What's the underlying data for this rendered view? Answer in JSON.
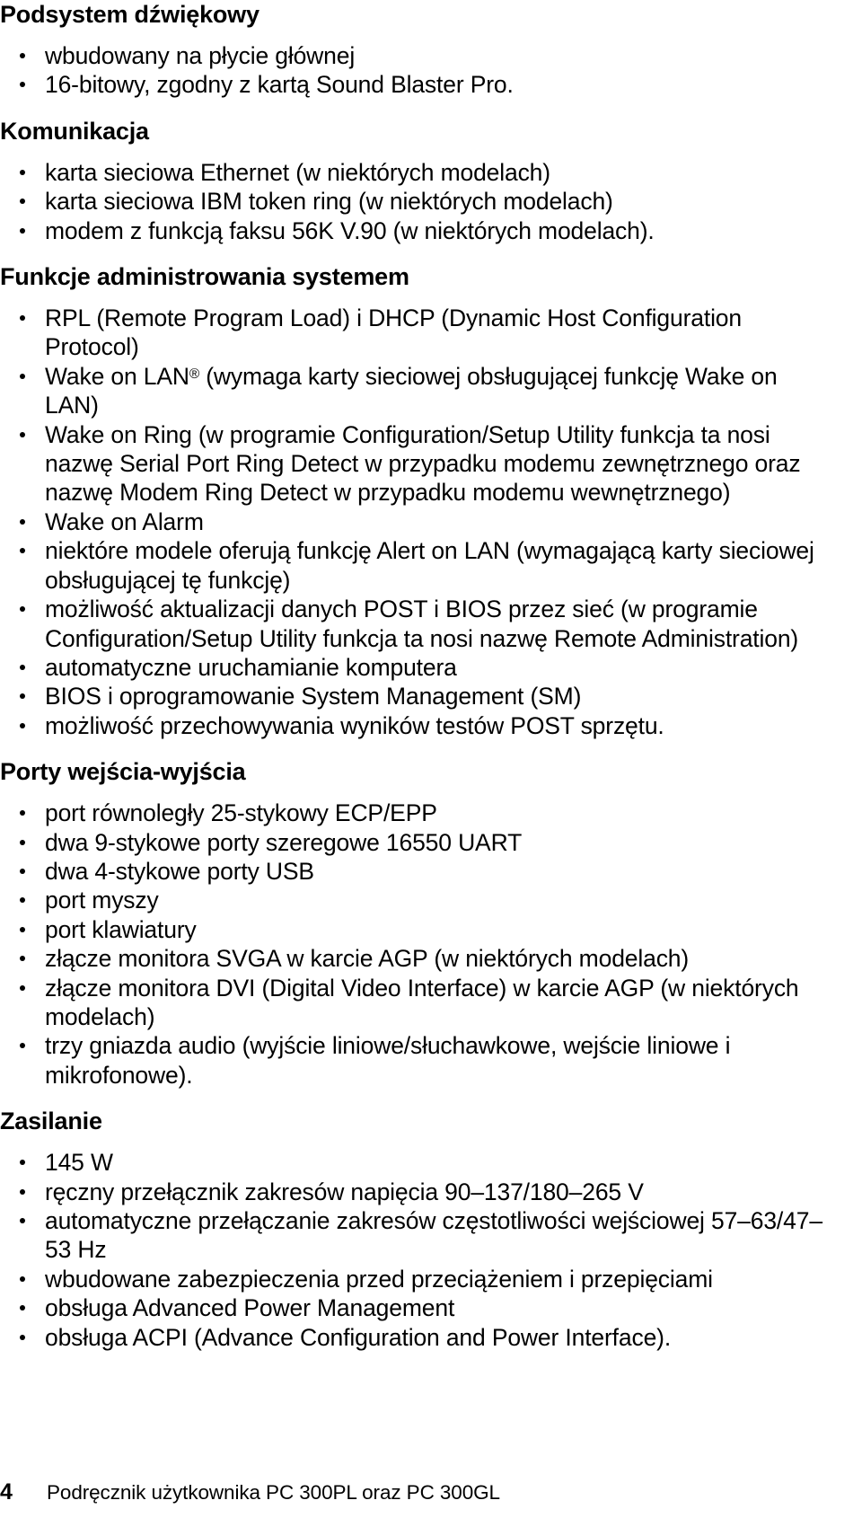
{
  "document": {
    "language": "pl",
    "page_number": "4",
    "footer_text": "Podręcznik użytkownika PC 300PL oraz PC 300GL"
  },
  "sections": [
    {
      "heading": "Podsystem dźwiękowy",
      "items": [
        "wbudowany na płycie głównej",
        "16-bitowy, zgodny z kartą Sound Blaster Pro."
      ]
    },
    {
      "heading": "Komunikacja",
      "items": [
        "karta sieciowa Ethernet (w niektórych modelach)",
        "karta sieciowa IBM token ring (w niektórych modelach)",
        "modem z funkcją faksu 56K V.90 (w niektórych modelach)."
      ]
    },
    {
      "heading": "Funkcje administrowania systemem",
      "items": [
        "RPL (Remote Program Load) i DHCP (Dynamic Host Configuration Protocol)",
        "Wake on LAN® (wymaga karty sieciowej obsługującej funkcję Wake on LAN)",
        "Wake on Ring (w programie Configuration/Setup Utility funkcja ta nosi nazwę Serial Port Ring Detect w przypadku modemu zewnętrznego oraz nazwę Modem Ring Detect w przypadku modemu wewnętrznego)",
        "Wake on Alarm",
        "niektóre modele oferują funkcję Alert on LAN (wymagającą karty sieciowej obsługującej tę funkcję)",
        "możliwość aktualizacji danych POST i BIOS przez sieć (w programie Configuration/Setup Utility funkcja ta nosi nazwę Remote Administration)",
        "automatyczne uruchamianie komputera",
        "BIOS i oprogramowanie System Management (SM)",
        "możliwość przechowywania wyników testów POST sprzętu."
      ]
    },
    {
      "heading": "Porty wejścia-wyjścia",
      "items": [
        "port równoległy 25-stykowy ECP/EPP",
        "dwa 9-stykowe porty szeregowe 16550 UART",
        "dwa 4-stykowe porty USB",
        "port myszy",
        "port klawiatury",
        "złącze monitora SVGA w karcie AGP (w niektórych modelach)",
        "złącze monitora DVI (Digital Video Interface) w karcie AGP (w niektórych modelach)",
        "trzy gniazda audio (wyjście liniowe/słuchawkowe, wejście liniowe i mikrofonowe)."
      ]
    },
    {
      "heading": "Zasilanie",
      "items": [
        "145 W",
        "ręczny przełącznik zakresów napięcia 90–137/180–265 V",
        "automatyczne przełączanie zakresów częstotliwości wejściowej 57–63/47–53 Hz",
        "wbudowane zabezpieczenia przed przeciążeniem i przepięciami",
        "obsługa Advanced Power Management",
        "obsługa ACPI (Advance Configuration and Power Interface)."
      ]
    }
  ],
  "colors": {
    "text": "#000000",
    "background": "#ffffff"
  }
}
